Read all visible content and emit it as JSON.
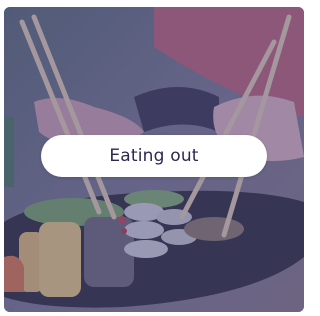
{
  "card": {
    "label": "Eating out",
    "image": "sushi-platter-with-chopsticks-photo"
  },
  "colors": {
    "overlay": "#46447880",
    "label_bg": "#ffffff",
    "label_text": "#2a2850"
  }
}
